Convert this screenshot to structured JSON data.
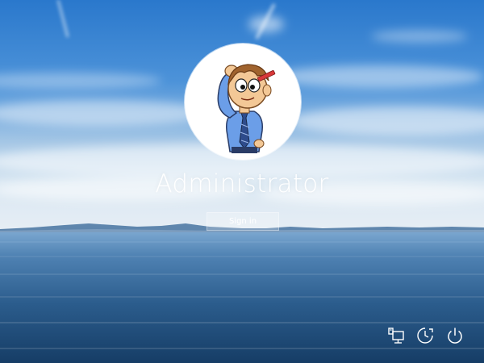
{
  "user": {
    "name": "Administrator"
  },
  "signin": {
    "label": "Sign in"
  },
  "tray": {
    "icons": [
      "network-icon",
      "ease-of-access-icon",
      "power-icon"
    ]
  },
  "colors": {
    "text": "#ffffff",
    "sky_top": "#2f7fd0",
    "sky_horizon": "#dde9f3",
    "sea_near": "#143a60"
  }
}
